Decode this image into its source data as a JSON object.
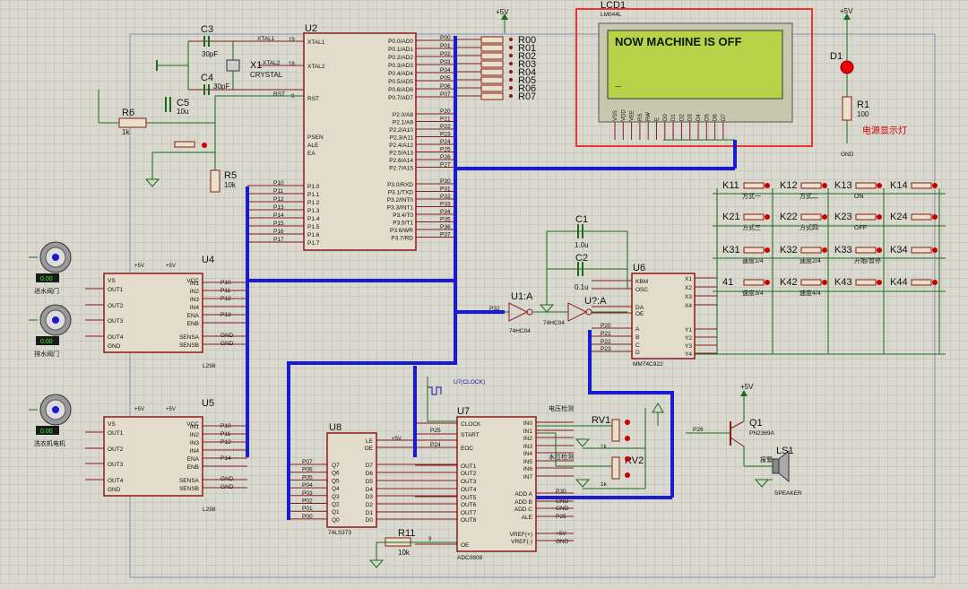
{
  "power": {
    "plus5v": "+5V",
    "gnd": "GND"
  },
  "u2": {
    "ref": "U2",
    "left": [
      "XTAL1",
      "XTAL2",
      "RST",
      "PSEN",
      "ALE",
      "EA"
    ],
    "pins": {
      "xtal1": "19",
      "xtal2": "18",
      "rst": "9"
    },
    "p1": [
      "P1.0",
      "P1.1",
      "P1.2",
      "P1.3",
      "P1.4",
      "P1.5",
      "P1.6",
      "P1.7"
    ],
    "p1nets": [
      "P10",
      "P11",
      "P12",
      "P13",
      "P14",
      "P15",
      "P16",
      "P17"
    ],
    "right": [
      "P0.0/AD0",
      "P0.1/AD1",
      "P0.2/AD2",
      "P0.3/AD3",
      "P0.4/AD4",
      "P0.5/AD5",
      "P0.6/AD6",
      "P0.7/AD7",
      "P2.0/A8",
      "P2.1/A9",
      "P2.2/A10",
      "P2.3/A11",
      "P2.4/A12",
      "P2.5/A13",
      "P2.6/A14",
      "P2.7/A15",
      "P3.0/RXD",
      "P3.1/TXD",
      "P3.2/INT0",
      "P3.3/INT1",
      "P3.4/T0",
      "P3.5/T1",
      "P3.6/WR",
      "P3.7/RD"
    ],
    "rightnets": [
      "P00",
      "P01",
      "P02",
      "P03",
      "P04",
      "P05",
      "P06",
      "P07",
      "P20",
      "P21",
      "P22",
      "P23",
      "P24",
      "P25",
      "P26",
      "P27",
      "P30",
      "P31",
      "P32",
      "P33",
      "P34",
      "P35",
      "P36",
      "P37"
    ]
  },
  "p0res": [
    "R00",
    "R01",
    "R02",
    "R03",
    "R04",
    "R05",
    "R06",
    "R07"
  ],
  "parts": {
    "c3": {
      "ref": "C3",
      "val": "30pF"
    },
    "c4": {
      "ref": "C4",
      "val": "30pF"
    },
    "x1": {
      "ref": "X1",
      "val": "CRYSTAL"
    },
    "xtal1_net": "XTAL1",
    "xtal2_net": "XTAL2",
    "rst_net": "RST",
    "r6": {
      "ref": "R6",
      "val": "1k"
    },
    "c5": {
      "ref": "C5",
      "val": "10u"
    },
    "r5": {
      "ref": "R5",
      "val": "10k"
    },
    "d1": {
      "ref": "D1"
    },
    "r1": {
      "ref": "R1",
      "val": "100",
      "note": "电源显示灯"
    },
    "c1": {
      "ref": "C1",
      "val": "1.0u"
    },
    "c2": {
      "ref": "C2",
      "val": "0.1u"
    },
    "u1a": {
      "ref": "U1:A",
      "model": "74HC04",
      "net": "P32"
    },
    "u1b": {
      "ref": "U?:A",
      "model": "74HC04"
    },
    "r11": {
      "ref": "R11",
      "val": "10k",
      "pin": "9"
    }
  },
  "lcd": {
    "ref": "LCD1",
    "model": "LM044L",
    "line1": "NOW MACHINE IS OFF",
    "line2": "_",
    "pins": [
      "VSS",
      "VDD",
      "VEE",
      "RS",
      "RW",
      "E",
      "D0",
      "D1",
      "D2",
      "D3",
      "D4",
      "D5",
      "D6",
      "D7"
    ]
  },
  "keypad": {
    "rows": [
      [
        {
          "ref": "K11",
          "note": "方式一"
        },
        {
          "ref": "K12",
          "note": "方式二"
        },
        {
          "ref": "K13",
          "note": "ON"
        },
        {
          "ref": "K14",
          "note": ""
        }
      ],
      [
        {
          "ref": "K21",
          "note": "方式三"
        },
        {
          "ref": "K22",
          "note": "方式四"
        },
        {
          "ref": "K23",
          "note": "OFF"
        },
        {
          "ref": "K24",
          "note": ""
        }
      ],
      [
        {
          "ref": "K31",
          "note": "速度1/4"
        },
        {
          "ref": "K32",
          "note": "速度2/4"
        },
        {
          "ref": "K33",
          "note": "开始/暂停"
        },
        {
          "ref": "K34",
          "note": ""
        }
      ],
      [
        {
          "ref": "41",
          "note": "速度3/4"
        },
        {
          "ref": "K42",
          "note": "速度4/4"
        },
        {
          "ref": "K43",
          "note": ""
        },
        {
          "ref": "K44",
          "note": ""
        }
      ]
    ]
  },
  "u6": {
    "ref": "U6",
    "model": "MM74C922",
    "left": [
      "KBM",
      "OSC",
      "DA",
      "OE",
      "A",
      "B",
      "C",
      "D"
    ],
    "leftnets": [
      "",
      "",
      "",
      "",
      "P20",
      "P21",
      "P22",
      "P23"
    ],
    "right": [
      "X1",
      "X2",
      "X3",
      "X4",
      "Y1",
      "Y2",
      "Y3",
      "Y4"
    ]
  },
  "u4": {
    "ref": "U4",
    "model": "L298",
    "left": [
      "VS",
      "OUT1",
      "OUT2",
      "OUT3",
      "OUT4",
      "GND"
    ],
    "right": [
      "VCC",
      "IN1",
      "IN2",
      "IN3",
      "IN4",
      "ENA",
      "ENB",
      "SENSA",
      "SENSB"
    ],
    "nets": [
      "P10",
      "P11",
      "P12",
      "P13",
      "GND",
      "GND"
    ]
  },
  "u5": {
    "ref": "U5",
    "model": "L298",
    "left": [
      "VS",
      "OUT1",
      "OUT2",
      "OUT3",
      "OUT4",
      "GND"
    ],
    "right": [
      "VCC",
      "IN1",
      "IN2",
      "IN3",
      "IN4",
      "ENA",
      "ENB",
      "SENSA",
      "SENSB"
    ],
    "nets": [
      "P10",
      "P11",
      "P12",
      "P14",
      "GND",
      "GND"
    ]
  },
  "motors": [
    {
      "label": "进水阀门",
      "reading": "0.00"
    },
    {
      "label": "排水阀门",
      "reading": "0.00"
    },
    {
      "label": "洗衣机电机",
      "reading": "0.00"
    }
  ],
  "u8": {
    "ref": "U8",
    "model": "74LS373",
    "right": [
      "LE",
      "OE",
      "D7",
      "D6",
      "D5",
      "D4",
      "D3",
      "D2",
      "D1",
      "D0"
    ],
    "left": [
      "Q7",
      "Q6",
      "Q5",
      "Q4",
      "Q3",
      "Q2",
      "Q1",
      "Q0"
    ],
    "leftnets": [
      "P07",
      "P06",
      "P05",
      "P04",
      "P03",
      "P02",
      "P01",
      "P00"
    ]
  },
  "u7": {
    "ref": "U7",
    "model": "ADC0808",
    "clock_label": "U7(CLOCK)",
    "left": [
      "CLOCK",
      "START",
      "EOC",
      "OUT1",
      "OUT2",
      "OUT3",
      "OUT4",
      "OUT5",
      "OUT6",
      "OUT7",
      "OUT8",
      "OE"
    ],
    "right": [
      "IN0",
      "IN1",
      "IN2",
      "IN3",
      "IN4",
      "IN5",
      "IN6",
      "IN7",
      "ADD A",
      "ADD B",
      "ADD C",
      "ALE",
      "VREF(+)",
      "VREF(-)"
    ],
    "rightnets": [
      "P30",
      "GND",
      "GND",
      "P25",
      "+5V",
      "GND"
    ],
    "leftnets": [
      "P25",
      "P24"
    ]
  },
  "sensors": {
    "voltage_label": "电压检测",
    "level_label": "水位检测",
    "rv1": "RV1",
    "rv2": "RV2",
    "pot_val": "1k"
  },
  "alarm": {
    "net": "P26",
    "q_ref": "Q1",
    "q_model": "PN2369A",
    "ls_ref": "LS1",
    "ls_model": "SPEAKER",
    "note": "报警"
  }
}
